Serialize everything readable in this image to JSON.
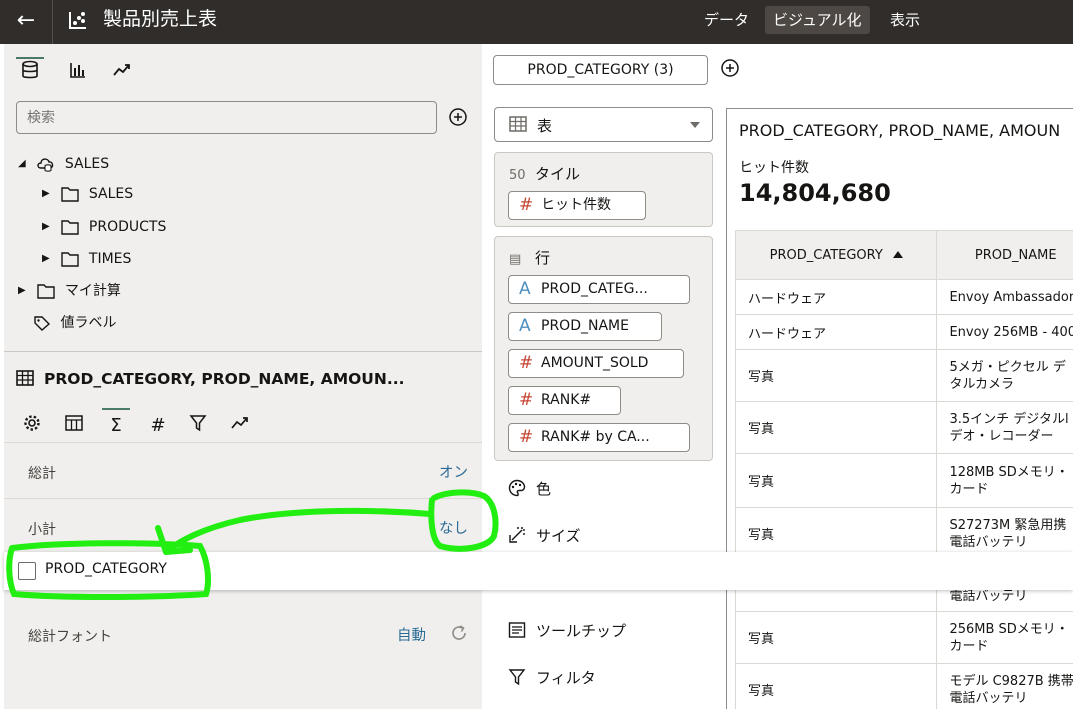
{
  "topbar": {
    "title": "製品別売上表",
    "tabs": [
      "データ",
      "ビジュアル化",
      "表示"
    ],
    "active_tab": "ビジュアル化"
  },
  "data_panel": {
    "tabs": [
      "data-icon",
      "chart-icon",
      "analytics-icon"
    ],
    "search_placeholder": "検索",
    "tree": [
      {
        "label": "SALES",
        "level": 0,
        "expanded": true,
        "icon": "cloud-database-icon"
      },
      {
        "label": "SALES",
        "level": 1,
        "expanded": false,
        "icon": "folder-icon"
      },
      {
        "label": "PRODUCTS",
        "level": 1,
        "expanded": false,
        "icon": "folder-icon"
      },
      {
        "label": "TIMES",
        "level": 1,
        "expanded": false,
        "icon": "folder-icon"
      },
      {
        "label": "マイ計算",
        "level": 0,
        "expanded": false,
        "icon": "folder-icon"
      },
      {
        "label": "値ラベル",
        "level": 0,
        "expanded": null,
        "icon": "tag-icon"
      }
    ]
  },
  "properties": {
    "viz_title": "PROD_CATEGORY, PROD_NAME, AMOUN...",
    "tabs": [
      "gear-icon",
      "table-icon",
      "sigma-icon",
      "hash-icon",
      "filter-icon",
      "analytics-icon"
    ],
    "rows": {
      "total_label": "総計",
      "total_value": "オン",
      "subtotal_label": "小計",
      "subtotal_value": "なし",
      "font_label": "総計フォント",
      "font_value": "自動"
    },
    "popup_option": "PROD_CATEGORY"
  },
  "grammar": {
    "filter_pill": "PROD_CATEGORY (3)",
    "vis_type": "表",
    "tile_header": "タイル",
    "tile_pills": [
      "ヒット件数"
    ],
    "rows_header": "行",
    "row_pills": [
      {
        "label": "PROD_CATEG...",
        "type": "alpha"
      },
      {
        "label": "PROD_NAME",
        "type": "alpha"
      },
      {
        "label": "AMOUNT_SOLD",
        "type": "hash"
      },
      {
        "label": "RANK#",
        "type": "hash"
      },
      {
        "label": "RANK# by CA...",
        "type": "hash"
      }
    ],
    "other_items": [
      "色",
      "サイズ",
      "ツールチップ",
      "フィルタ"
    ]
  },
  "canvas": {
    "title": "PROD_CATEGORY, PROD_NAME, AMOUN",
    "kpi_label": "ヒット件数",
    "kpi_value": "14,804,680",
    "columns": [
      "PROD_CATEGORY",
      "PROD_NAME"
    ],
    "rows": [
      [
        "ハードウェア",
        "Envoy Ambassador"
      ],
      [
        "ハードウェア",
        "Envoy 256MB - 400"
      ],
      [
        "写真",
        "5メガ・ピクセル デ\nタルカメラ"
      ],
      [
        "写真",
        "3.5インチ デジタルl\nデオ・レコーダー"
      ],
      [
        "写真",
        "128MB SDメモリ・\nカード"
      ],
      [
        "写真",
        "S27273M 緊急用携\n電話バッテリ"
      ],
      [
        "",
        "電話バッテリ"
      ],
      [
        "写真",
        "256MB SDメモリ・\nカード"
      ],
      [
        "写真",
        "モデル C9827B 携帯\n電話バッテリ"
      ]
    ]
  },
  "colors": {
    "topbar_bg": "#312d2a",
    "panel_bg": "#f1efed",
    "link_blue": "#2a6b96",
    "annotation_green": "#22ee11",
    "measure_red": "#c74634",
    "attribute_blue": "#4f8fbf"
  }
}
